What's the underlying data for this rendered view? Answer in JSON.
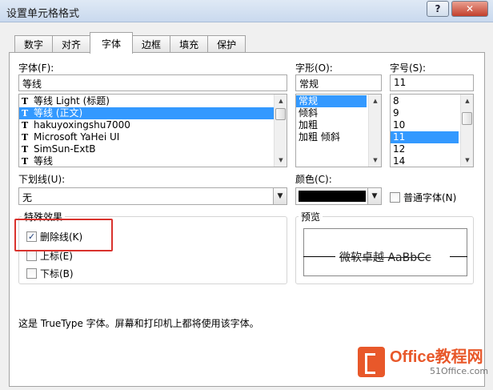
{
  "window": {
    "title": "设置单元格格式",
    "help_glyph": "?",
    "close_glyph": "✕"
  },
  "tabs": [
    {
      "label": "数字"
    },
    {
      "label": "对齐"
    },
    {
      "label": "字体"
    },
    {
      "label": "边框"
    },
    {
      "label": "填充"
    },
    {
      "label": "保护"
    }
  ],
  "font": {
    "label": "字体(F):",
    "value": "等线",
    "items": [
      {
        "label": "等线 Light (标题)"
      },
      {
        "label": "等线 (正文)"
      },
      {
        "label": "hakuyoxingshu7000"
      },
      {
        "label": "Microsoft YaHei UI"
      },
      {
        "label": "SimSun-ExtB"
      },
      {
        "label": "等线"
      }
    ]
  },
  "style": {
    "label": "字形(O):",
    "value": "常规",
    "items": [
      {
        "label": "常规"
      },
      {
        "label": "倾斜"
      },
      {
        "label": "加粗"
      },
      {
        "label": "加粗 倾斜"
      }
    ]
  },
  "size": {
    "label": "字号(S):",
    "value": "11",
    "items": [
      {
        "label": "8"
      },
      {
        "label": "9"
      },
      {
        "label": "10"
      },
      {
        "label": "11"
      },
      {
        "label": "12"
      },
      {
        "label": "14"
      }
    ]
  },
  "underline": {
    "label": "下划线(U):",
    "value": "无"
  },
  "color": {
    "label": "颜色(C):",
    "swatch": "#000000",
    "normal_font_label": "普通字体(N)"
  },
  "effects": {
    "title": "特殊效果",
    "strikethrough": {
      "label": "删除线(K)",
      "checked": true
    },
    "superscript": {
      "label": "上标(E)",
      "checked": false
    },
    "subscript": {
      "label": "下标(B)",
      "checked": false
    }
  },
  "preview": {
    "title": "预览",
    "text": "微软卓越 AaBbCc"
  },
  "info": "这是 TrueType 字体。屏幕和打印机上都将使用该字体。",
  "watermark": {
    "brand": "Office教程网",
    "sub": "51Office.com"
  },
  "colors": {
    "selection": "#3399ff",
    "highlight": "#d9322d",
    "brand": "#e8582a"
  }
}
